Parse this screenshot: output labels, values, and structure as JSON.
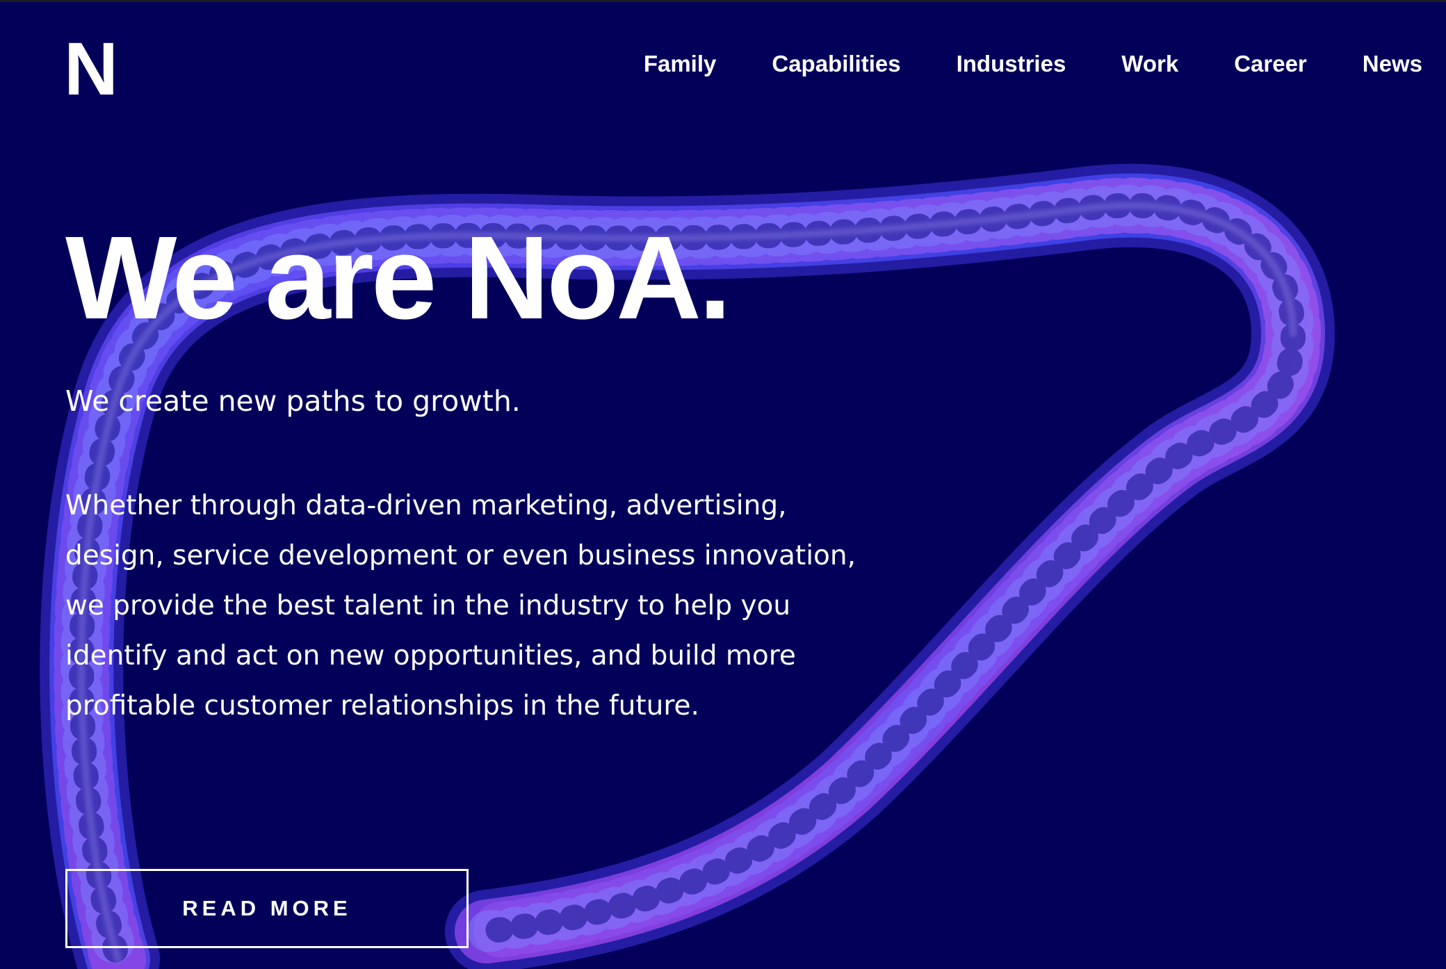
{
  "header": {
    "logo_text": "N",
    "nav": [
      {
        "label": "Family"
      },
      {
        "label": "Capabilities"
      },
      {
        "label": "Industries"
      },
      {
        "label": "Work"
      },
      {
        "label": "Career"
      },
      {
        "label": "News"
      }
    ]
  },
  "hero": {
    "title": "We are NoA.",
    "tagline": "We create new paths to growth.",
    "body": "Whether through data-driven marketing, advertising, design, service development or even business innovation, we provide the best talent in the industry to help you identify and act on new opportunities, and build more profitable customer relationships in the future.",
    "cta_label": "READ MORE"
  },
  "colors": {
    "background": "#03005a",
    "text": "#ffffff",
    "loop_blue": "#4a3ee0",
    "loop_violet": "#9a3fe0"
  },
  "icons": {
    "decorative_art": "twisted-loop-illustration"
  }
}
